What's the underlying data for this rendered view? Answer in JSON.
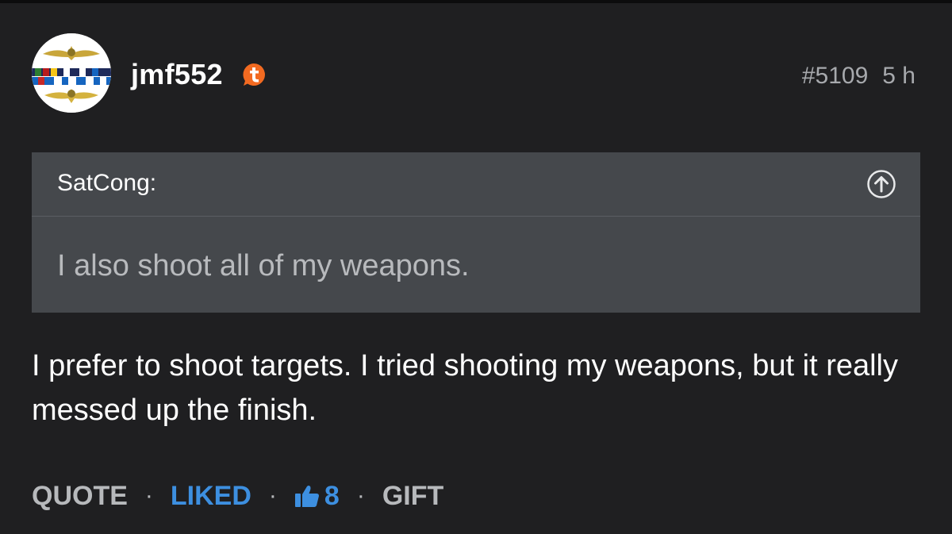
{
  "post": {
    "username": "jmf552",
    "post_number": "#5109",
    "time_ago": "5 h",
    "avatar_icon": "naval-insignia-avatar",
    "badge_icon": "tapatalk-badge-icon",
    "quote": {
      "author": "SatCong:",
      "text": "I also shoot all of my weapons.",
      "jump_icon": "arrow-up-circle-icon"
    },
    "body": "I prefer to shoot targets. I tried shooting my weapons, but it really messed up the finish."
  },
  "actions": {
    "quote_label": "QUOTE",
    "liked_label": "LIKED",
    "like_count": "8",
    "gift_label": "GIFT",
    "separator": "·",
    "like_icon": "thumbs-up-icon"
  },
  "colors": {
    "background": "#1f1f21",
    "quote_box": "#45484c",
    "accent_blue": "#3d8fe0",
    "badge_orange": "#f26a21",
    "muted_text": "#a7a9ad"
  }
}
